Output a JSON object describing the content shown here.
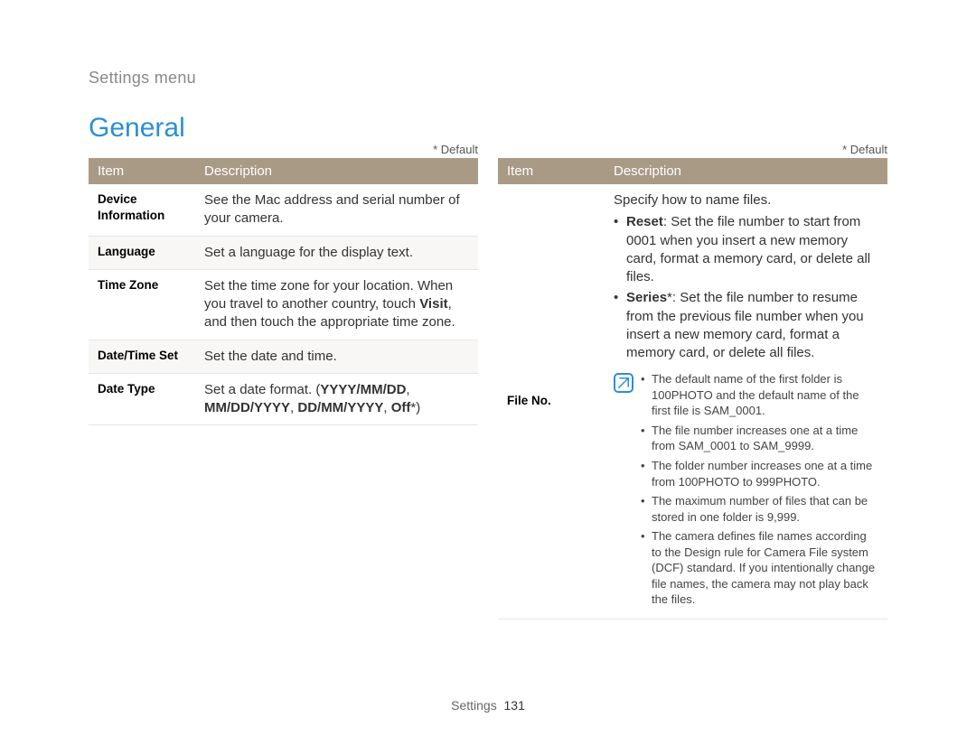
{
  "breadcrumb": "Settings menu",
  "section_title": "General",
  "default_marker": "* Default",
  "headers": {
    "item": "Item",
    "description": "Description"
  },
  "left_table": {
    "rows": [
      {
        "item": "Device Information",
        "desc": "See the Mac address and serial number of your camera."
      },
      {
        "item": "Language",
        "desc": "Set a language for the display text."
      },
      {
        "item": "Time Zone",
        "desc_pre": "Set the time zone for your location. When you travel to another country, touch ",
        "desc_bold": "Visit",
        "desc_post": ", and then touch the appropriate time zone."
      },
      {
        "item": "Date/Time Set",
        "desc": "Set the date and time."
      },
      {
        "item": "Date Type",
        "desc_pre": "Set a date format. (",
        "desc_bold": "YYYY/MM/DD",
        "desc_mid": ", ",
        "desc_bold2": "MM/DD/YYYY",
        "desc_mid2": ", ",
        "desc_bold3": "DD/MM/YYYY",
        "desc_mid3": ", ",
        "desc_bold4": "Off",
        "desc_post": "*)"
      }
    ]
  },
  "right_table": {
    "item": "File No.",
    "intro": "Specify how to name files.",
    "bullets": [
      {
        "label": "Reset",
        "text": ": Set the file number to start from 0001 when you insert a new memory card, format a memory card, or delete all files."
      },
      {
        "label": "Series",
        "suffix": "*",
        "text": ": Set the file number to resume from the previous file number when you insert a new memory card, format a memory card, or delete all files."
      }
    ],
    "notes": [
      "The default name of the first folder is 100PHOTO and the default name of the first file is SAM_0001.",
      "The file number increases one at a time from SAM_0001 to SAM_9999.",
      "The folder number increases one at a time from 100PHOTO to 999PHOTO.",
      "The maximum number of files that can be stored in one folder is 9,999.",
      "The camera defines file names according to the Design rule for Camera File system (DCF) standard. If you intentionally change file names, the camera may not play back the files."
    ]
  },
  "footer": {
    "section": "Settings",
    "page": "131"
  }
}
